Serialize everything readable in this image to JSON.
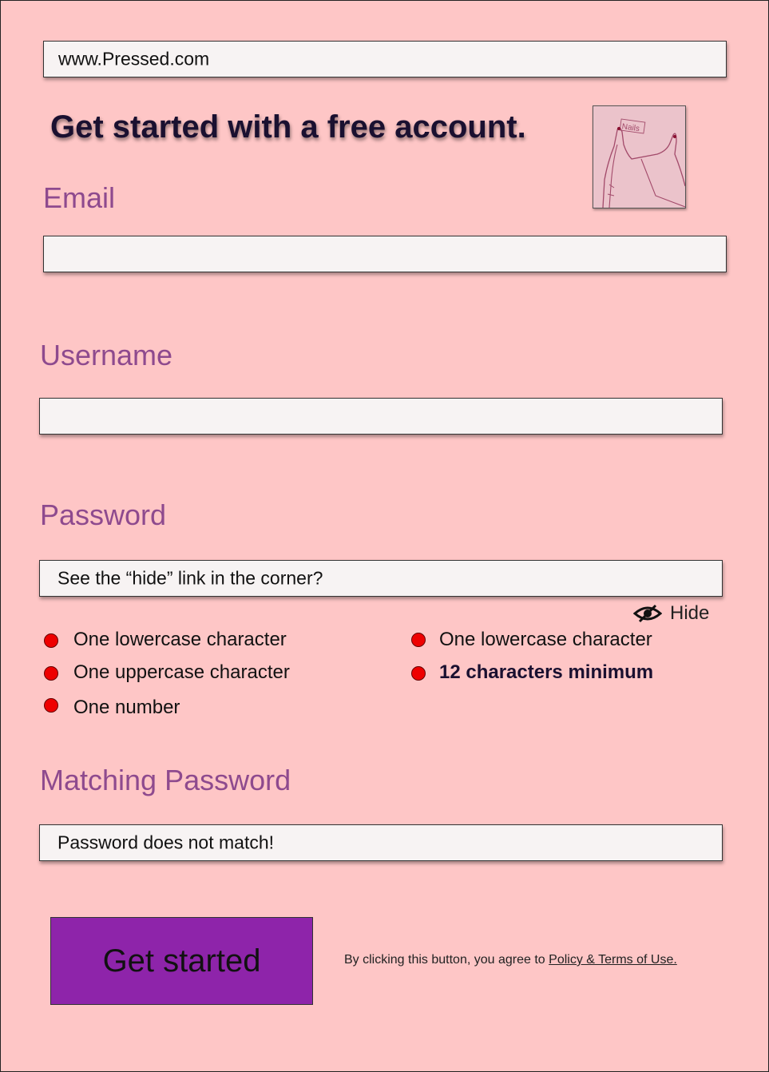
{
  "address_bar": {
    "url": "www.Pressed.com"
  },
  "header": {
    "headline": "Get started with a free account.",
    "thumbnail_text": "Nails"
  },
  "email": {
    "label": "Email",
    "value": ""
  },
  "username": {
    "label": "Username",
    "value": ""
  },
  "password": {
    "label": "Password",
    "value": "See the “hide” link in the corner?",
    "toggle_label": "Hide",
    "toggle_icon": "eye-slash-icon"
  },
  "requirements": {
    "left": [
      {
        "text": "One lowercase character",
        "met": false
      },
      {
        "text": "One uppercase character",
        "met": false
      },
      {
        "text": "One number",
        "met": false
      }
    ],
    "right": [
      {
        "text": "One lowercase character",
        "met": false
      },
      {
        "text": "12 characters minimum",
        "met": false
      }
    ]
  },
  "matching_password": {
    "label": "Matching Password",
    "value": "Password does not match!"
  },
  "submit": {
    "label": "Get started"
  },
  "terms": {
    "prefix": "By clicking this button, you agree to ",
    "link_text": "Policy & Terms of Use."
  },
  "colors": {
    "background": "#fec6c6",
    "label": "#8e4a8e",
    "button": "#8e24aa",
    "unmet_dot": "#ee0000"
  }
}
